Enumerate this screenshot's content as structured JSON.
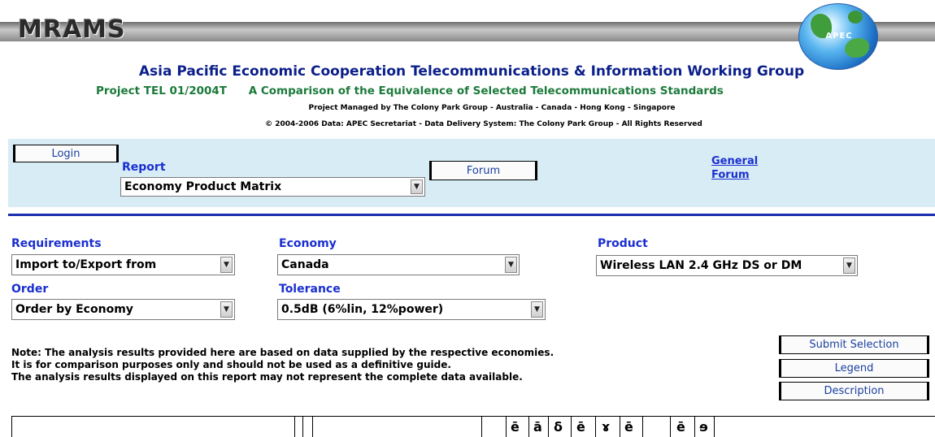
{
  "header": {
    "logo_text": "MRAMS",
    "globe_text": "APEC",
    "title": "Asia Pacific Economic Cooperation Telecommunications & Information Working Group",
    "project_code": "Project TEL 01/2004T",
    "project_name": "A Comparison of the Equivalence of Selected Telecommunications Standards",
    "managed_by": "Project Managed by The Colony Park Group - Australia - Canada - Hong Kong - Singapore",
    "copyright": "© 2004-2006 Data: APEC Secretariat - Data Delivery System: The Colony Park Group - All Rights Reserved"
  },
  "toolbar": {
    "login_label": "Login",
    "report_label": "Report",
    "report_value": "Economy Product Matrix",
    "forum_label": "Forum",
    "general_forum_line1": "General",
    "general_forum_line2": "Forum"
  },
  "filters": {
    "requirements_label": "Requirements",
    "requirements_value": "Import to/Export from",
    "economy_label": "Economy",
    "economy_value": "Canada",
    "product_label": "Product",
    "product_value": "Wireless LAN 2.4 GHz DS or DM",
    "order_label": "Order",
    "order_value": "Order by Economy",
    "tolerance_label": "Tolerance",
    "tolerance_value": "0.5dB (6%lin, 12%power)"
  },
  "note": {
    "line1": "Note: The analysis results provided here are based on data supplied by the respective economies.",
    "line2": "It is for comparison purposes only and should not be used as a definitive guide.",
    "line3": "The analysis results displayed on this report may not represent the complete data available."
  },
  "actions": {
    "submit_label": "Submit Selection",
    "legend_label": "Legend",
    "description_label": "Description"
  },
  "table_header": {
    "glyphs": [
      "ē",
      "ā",
      "δ",
      "ē",
      "ɤ",
      "ē",
      "ē",
      "ɘ"
    ]
  },
  "colors": {
    "title_blue": "#0b1f8a",
    "subtitle_green": "#1b7a3a",
    "label_blue": "#1a2fd0",
    "toolbar_bg": "#d8ecf6",
    "divider_blue": "#1a2fb0"
  }
}
